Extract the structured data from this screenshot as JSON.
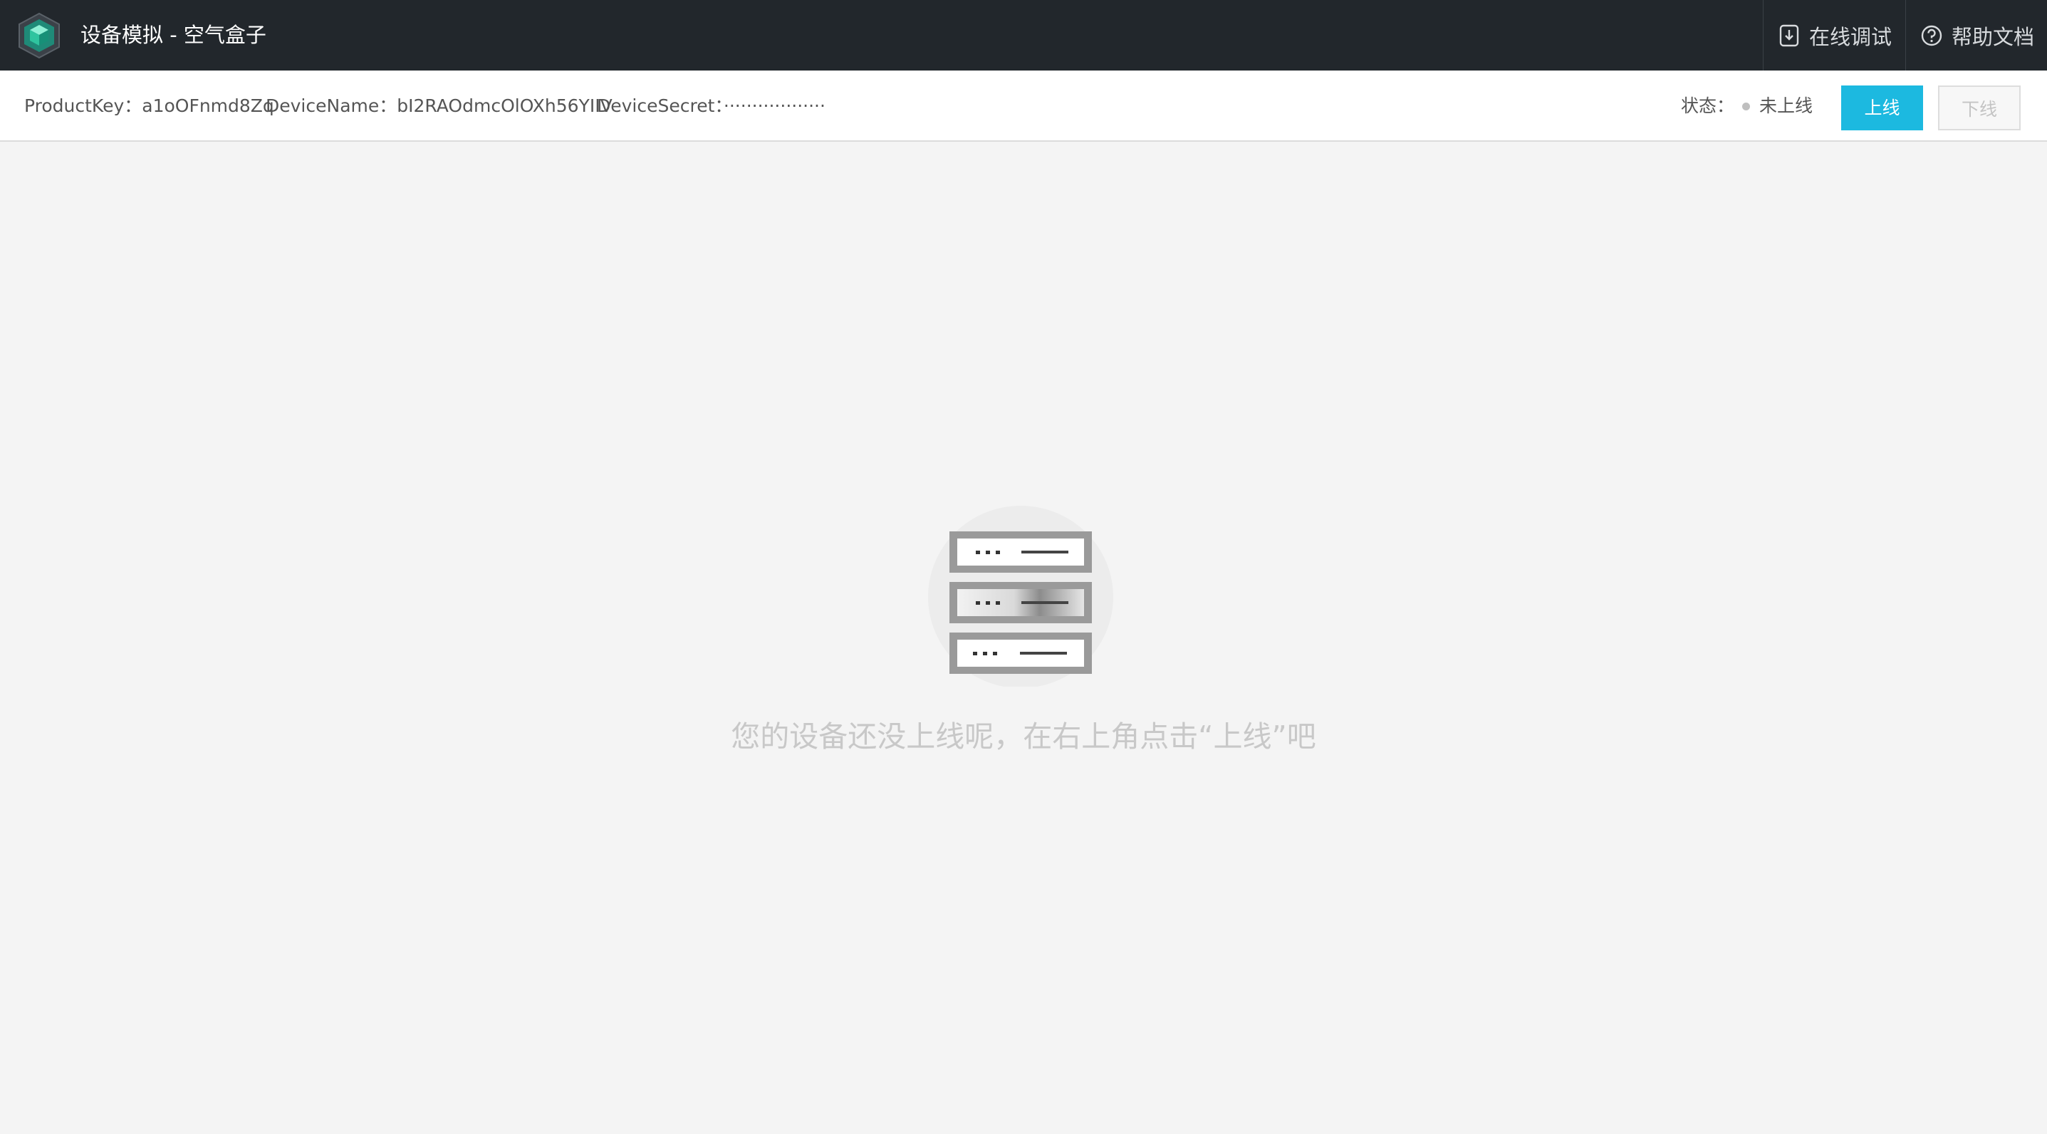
{
  "header": {
    "title": "设备模拟 - 空气盒子",
    "logo_icon": "hexagon-cube-logo",
    "links": [
      {
        "label": "在线调试",
        "icon": "download-doc-icon"
      },
      {
        "label": "帮助文档",
        "icon": "question-circle-icon"
      }
    ]
  },
  "device_info": {
    "product_key": "ProductKey：a1oOFnmd8Zq",
    "device_name": "DeviceName：bI2RAOdmcOlOXh56YIIV",
    "device_secret": "DeviceSecret：··················"
  },
  "status": {
    "label": "状态：",
    "value": "未上线",
    "dot_color": "#bfbfbf"
  },
  "buttons": {
    "online": "上线",
    "offline": "下线"
  },
  "empty_state": {
    "icon": "server-rack-icon",
    "message": "您的设备还没上线呢，在右上角点击“上线”吧"
  },
  "colors": {
    "topbar_bg": "#22272c",
    "accent": "#1cb9e0",
    "content_bg": "#f4f4f4"
  }
}
